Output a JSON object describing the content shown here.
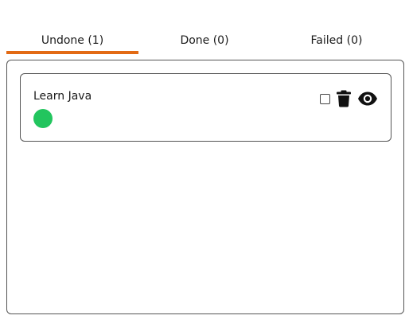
{
  "tabs": [
    {
      "label": "Undone (1)",
      "active": true
    },
    {
      "label": "Done (0)",
      "active": false
    },
    {
      "label": "Failed (0)",
      "active": false
    }
  ],
  "tasks": [
    {
      "title": "Learn Java",
      "status_color": "#22c55e",
      "checked": false,
      "icons": [
        "trash-icon",
        "eye-icon"
      ]
    }
  ],
  "colors": {
    "accent": "#e26a14",
    "status_green": "#22c55e"
  }
}
